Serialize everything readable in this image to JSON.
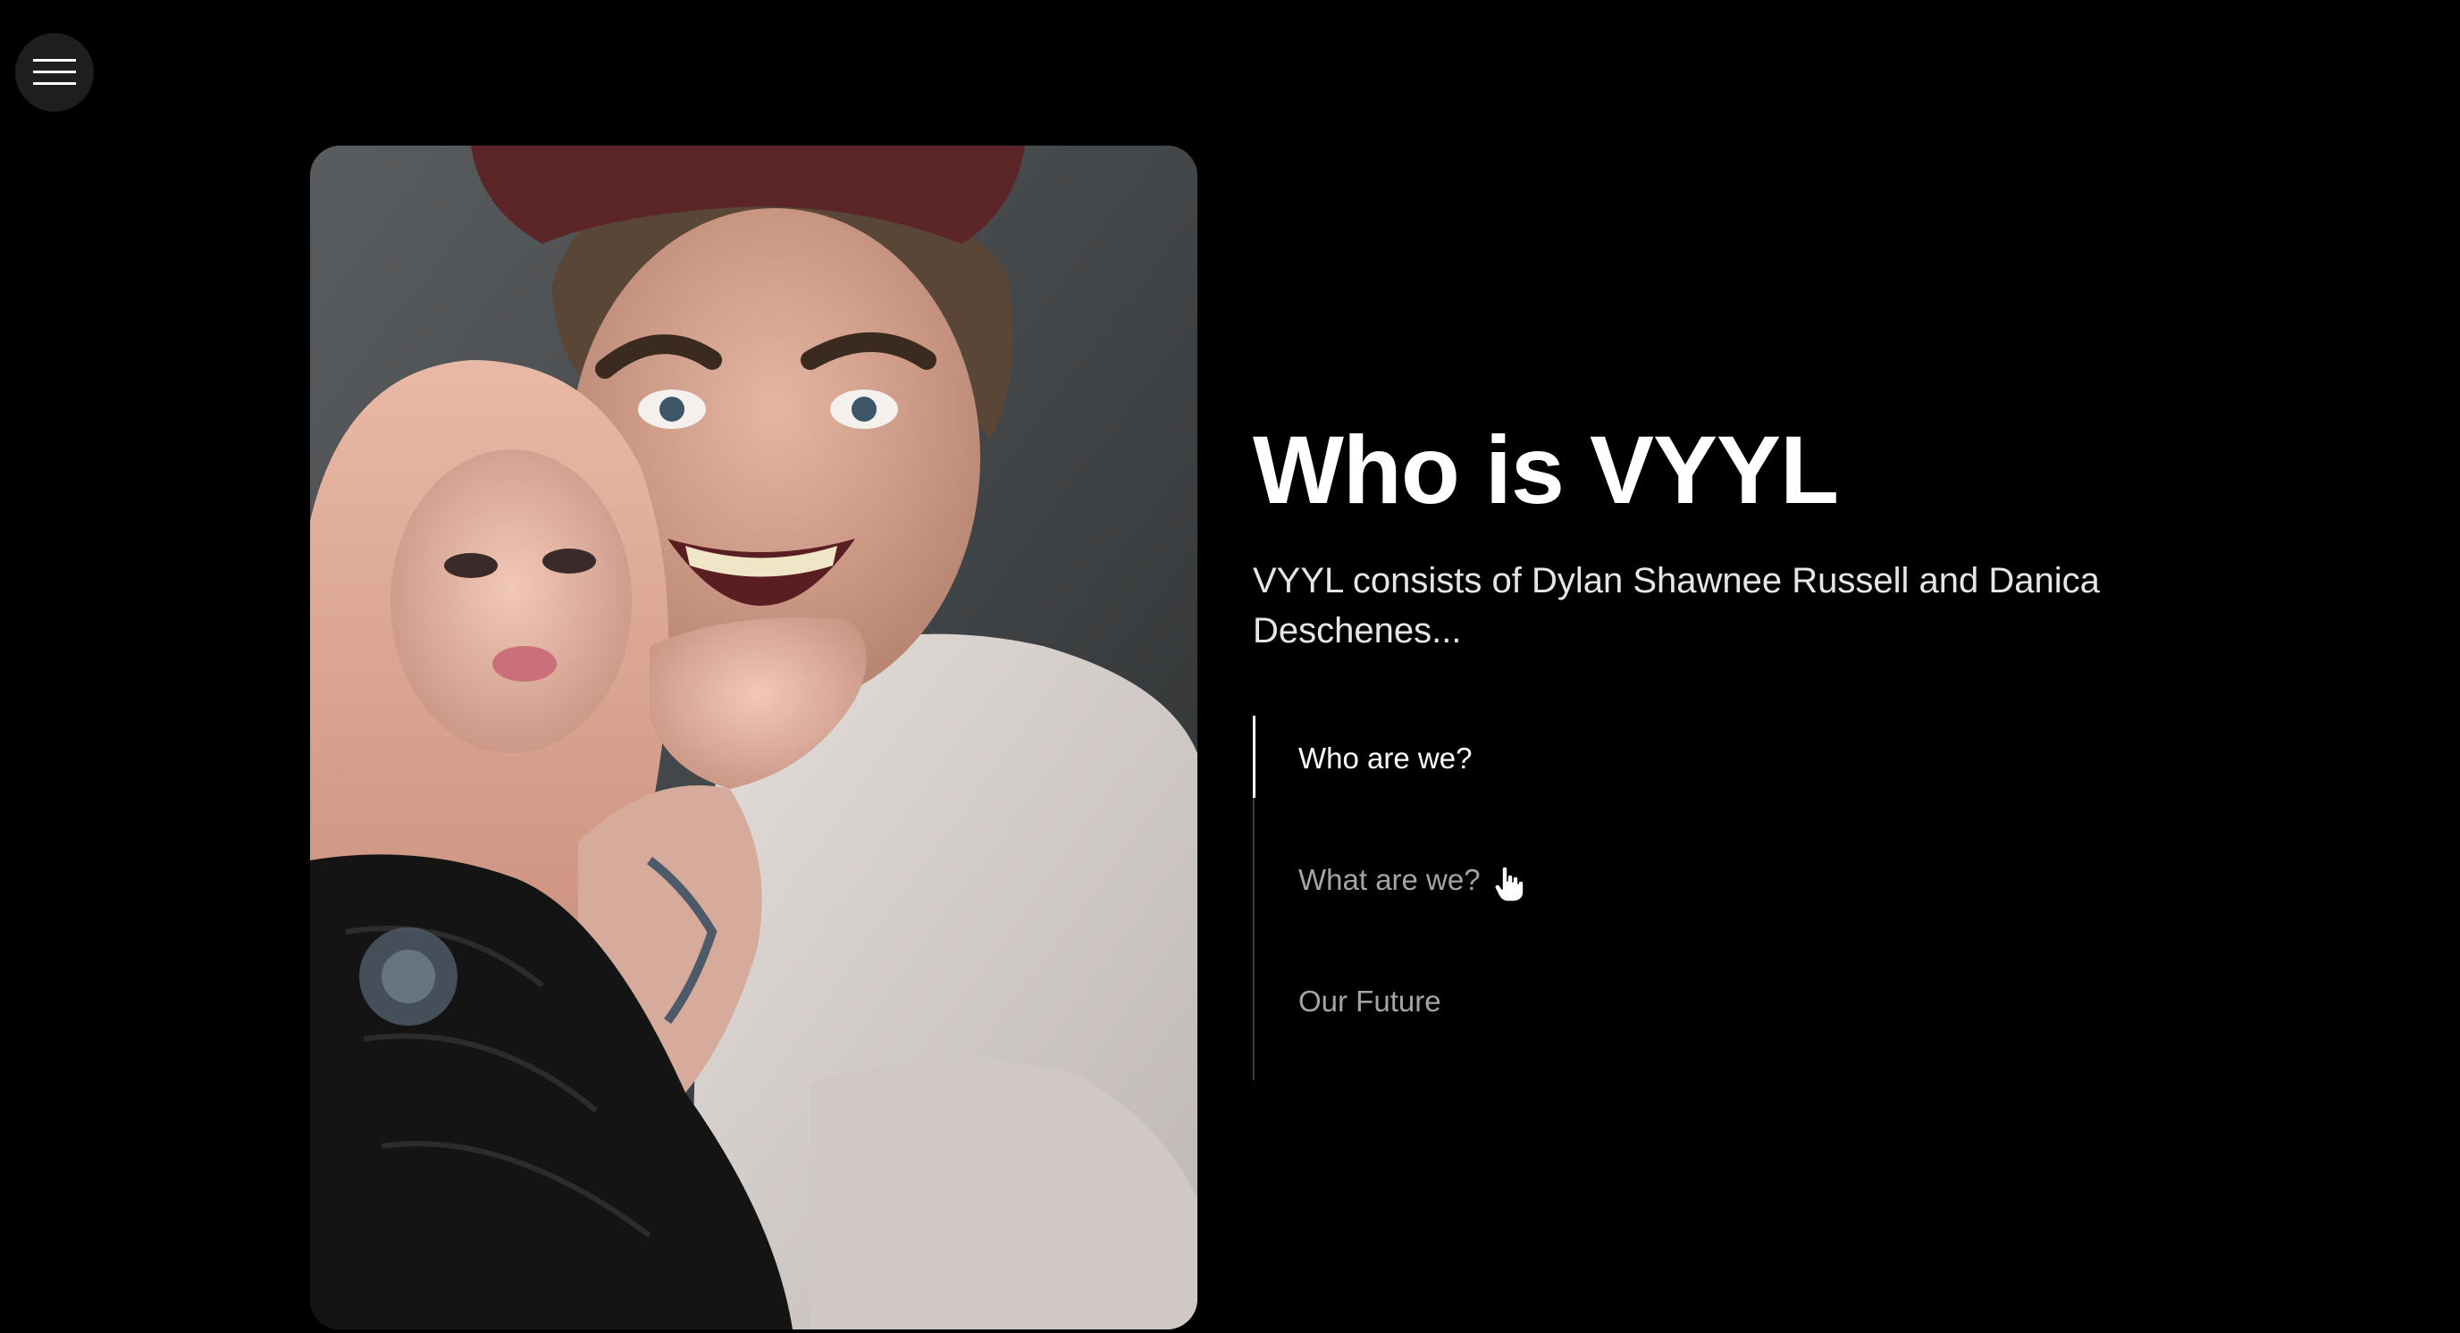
{
  "menu": {
    "icon": "hamburger-menu-icon"
  },
  "hero": {
    "photo_description": "",
    "title": "Who is VYYL",
    "intro": "VYYL consists of Dylan Shawnee Russell and Danica Deschenes..."
  },
  "sub_nav": {
    "items": [
      {
        "label": "Who are we?",
        "active": true
      },
      {
        "label": "What are we?",
        "active": false
      },
      {
        "label": "Our Future",
        "active": false
      }
    ]
  },
  "colors": {
    "background": "#000000",
    "menu_button_bg": "#1e1e1e",
    "active_text": "#ffffff",
    "inactive_text": "#a4a4a4",
    "divider": "#3a3a3a"
  }
}
